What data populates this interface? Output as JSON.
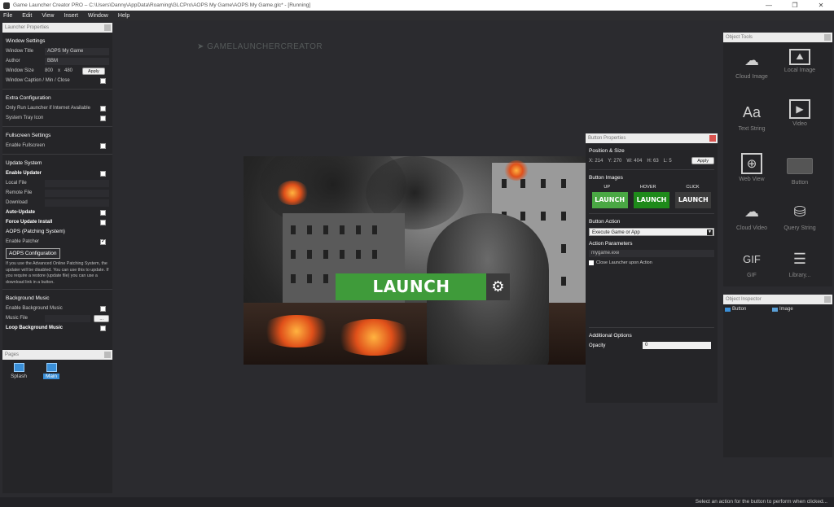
{
  "window": {
    "title": "Game Launcher Creator PRO – C:\\Users\\Danny\\AppData\\Roaming\\GLCPro\\AOPS My Game\\AOPS My Game.glc* - [Running]",
    "controls": [
      "—",
      "❐",
      "✕"
    ]
  },
  "menu": [
    "File",
    "Edit",
    "View",
    "Insert",
    "Window",
    "Help"
  ],
  "launcher_properties": {
    "header": "Launcher Properties",
    "window_settings": {
      "title": "Window Settings",
      "window_title_label": "Window Title",
      "window_title_value": "AOPS My Game",
      "author_label": "Author",
      "author_value": "BBM",
      "window_size_label": "Window Size",
      "width": "800",
      "x_sep": "x",
      "height": "480",
      "apply": "Apply",
      "caption_label": "Window Caption / Min / Close"
    },
    "extra": {
      "title": "Extra Configuration",
      "internet_label": "Only Run Launcher if Internet Available",
      "tray_label": "System Tray Icon"
    },
    "fullscreen": {
      "title": "Fullscreen Settings",
      "enable_label": "Enable Fullscreen"
    },
    "update": {
      "title": "Update System",
      "enable_updater": "Enable Updater",
      "local_file": "Local File",
      "remote_file": "Remote File",
      "download": "Download",
      "auto_update": "Auto-Update",
      "force_update": "Force Update Install",
      "aops_title": "AOPS (Patching System)",
      "enable_patcher": "Enable Patcher",
      "aops_button": "AOPS Configuration",
      "note": "If you use the Advanced Online Patching System, the updater will be disabled. You can use this to update. If you require a restore (update file) you can use a download link in a button."
    },
    "music": {
      "title": "Background Music",
      "enable_label": "Enable Background Music",
      "file_label": "Music File",
      "browse": "...",
      "loop_label": "Loop Background Music"
    }
  },
  "pages": {
    "header": "Pages",
    "items": [
      "Splash",
      "Main"
    ]
  },
  "logo": "GAMELAUNCHERCREATOR",
  "canvas": {
    "launch_text": "LAUNCH",
    "gear": "⚙"
  },
  "button_properties": {
    "header": "Button Properties",
    "position_title": "Position & Size",
    "x_label": "X:",
    "x": "214",
    "y_label": "Y:",
    "y": "270",
    "w_label": "W:",
    "w": "404",
    "h_label": "H:",
    "h": "63",
    "l_label": "L:",
    "l": "5",
    "apply": "Apply",
    "images_title": "Button Images",
    "states": [
      "UP",
      "HOVER",
      "CLICK"
    ],
    "tile_text": "LAUNCH",
    "action_title": "Button Action",
    "action_value": "Execute Game or App",
    "params_title": "Action Parameters",
    "params_value": "mygame.exe",
    "close_label": "Close Launcher upon Action",
    "additional_title": "Additional Options",
    "opacity_label": "Opacity",
    "opacity_value": "0"
  },
  "object_tools": {
    "header": "Object Tools",
    "items": [
      "Cloud Image",
      "Local Image",
      "Text String",
      "Video",
      "Web View",
      "Button",
      "Cloud Video",
      "Query String",
      "GIF",
      "Library..."
    ],
    "gif_glyph": "GIF",
    "text_glyph": "Aa"
  },
  "inspector": {
    "header": "Object Inspector",
    "items": [
      "Button",
      "Image"
    ]
  },
  "status": "Select an action for the button to perform when clicked..."
}
